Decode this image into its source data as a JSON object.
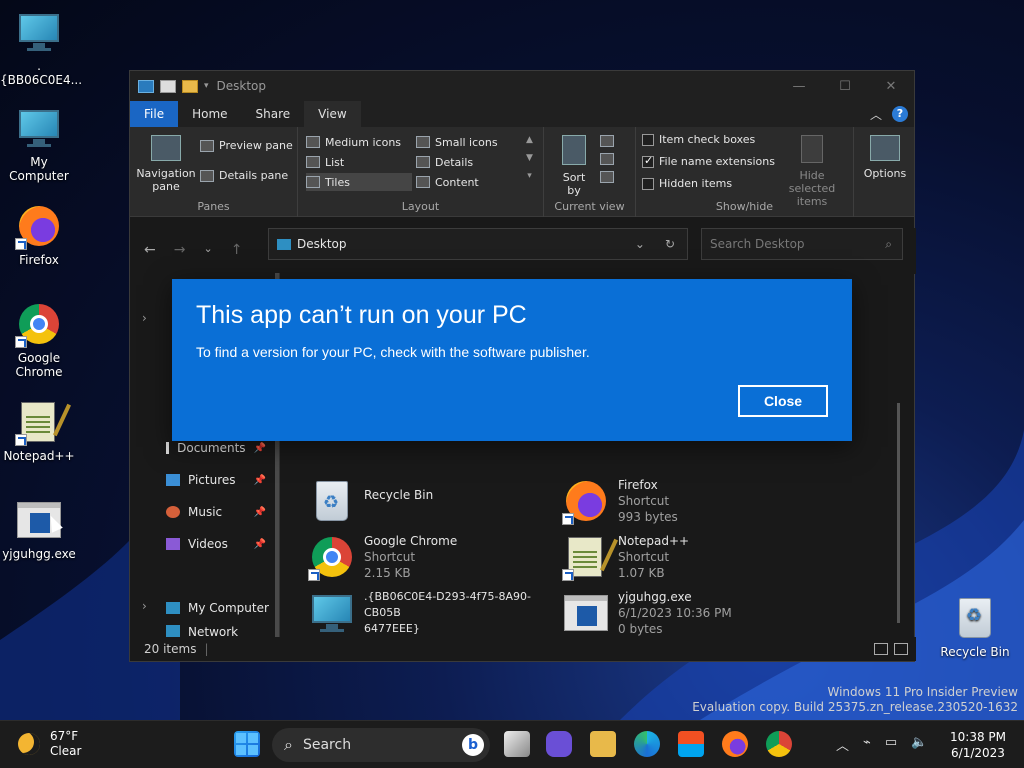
{
  "desktop": {
    "icons": [
      {
        "label": ".{BB06C0E4..."
      },
      {
        "label": "My Computer"
      },
      {
        "label": "Firefox"
      },
      {
        "label": "Google Chrome"
      },
      {
        "label": "Notepad++"
      },
      {
        "label": "yjguhgg.exe"
      },
      {
        "label": "Recycle Bin"
      }
    ]
  },
  "explorer": {
    "title": "Desktop",
    "tabs": [
      "File",
      "Home",
      "Share",
      "View"
    ],
    "ribbon": {
      "panes": {
        "navigation_pane": "Navigation pane",
        "preview_pane": "Preview pane",
        "details_pane": "Details pane",
        "label": "Panes"
      },
      "layout": {
        "items": [
          "Medium icons",
          "Small icons",
          "List",
          "Details",
          "Tiles",
          "Content"
        ],
        "selected": "Tiles",
        "label": "Layout"
      },
      "current_view": {
        "sort_by": "Sort by",
        "label": "Current view"
      },
      "show_hide": {
        "item_check_boxes": "Item check boxes",
        "file_name_extensions": "File name extensions",
        "hidden_items": "Hidden items",
        "hide_selected_items": "Hide selected items",
        "label": "Show/hide",
        "file_name_extensions_checked": true
      },
      "options": "Options"
    },
    "address": "Desktop",
    "search_placeholder": "Search Desktop",
    "nav": {
      "documents": "Documents",
      "pictures": "Pictures",
      "music": "Music",
      "videos": "Videos",
      "my_computer": "My Computer",
      "network": "Network"
    },
    "files": {
      "recycle_bin": {
        "name": "Recycle Bin"
      },
      "firefox": {
        "name": "Firefox",
        "type": "Shortcut",
        "size": "993 bytes"
      },
      "chrome": {
        "name": "Google Chrome",
        "type": "Shortcut",
        "size": "2.15 KB"
      },
      "notepad": {
        "name": "Notepad++",
        "type": "Shortcut",
        "size": "1.07 KB"
      },
      "clsid": {
        "name_line1": ".{BB06C0E4-D293-4f75-8A90-CB05B",
        "name_line2": "6477EEE}"
      },
      "exe": {
        "name": "yjguhgg.exe",
        "date": "6/1/2023 10:36 PM",
        "size": "0 bytes"
      }
    },
    "status": "20 items"
  },
  "dialog": {
    "title": "This app can’t run on your PC",
    "message": "To find a version for your PC, check with the software publisher.",
    "close_label": "Close",
    "color": "#0a6fd6"
  },
  "watermark": {
    "line1": "Windows 11 Pro Insider Preview",
    "line2": "Evaluation copy. Build 25375.zn_release.230520-1632"
  },
  "taskbar": {
    "weather_temp": "67°F",
    "weather_desc": "Clear",
    "search_label": "Search",
    "time": "10:38 PM",
    "date": "6/1/2023"
  }
}
